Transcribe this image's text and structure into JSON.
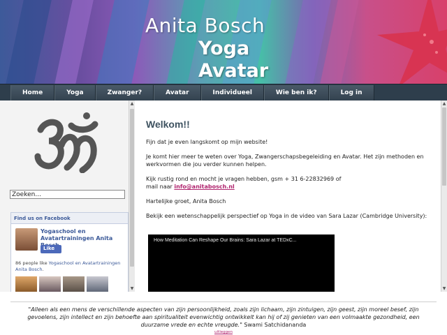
{
  "header": {
    "name": "Anita Bosch",
    "line1": "Yoga",
    "line2": "Avatar"
  },
  "nav": {
    "items": [
      "Home",
      "Yoga",
      "Zwanger?",
      "Avatar",
      "Individueel",
      "Wie ben ik?",
      "Log in"
    ]
  },
  "sidebar": {
    "om_icon": "om-symbol-icon",
    "search_value": "Zoeken...",
    "facebook": {
      "heading": "Find us on Facebook",
      "page_name": "Yogaschool en Avatartrainingen Anita Bosch",
      "like_label": "Like",
      "likes_count_text": "86 people like ",
      "likes_link": "Yogaschool en Avatartrainingen Anita Bosch",
      "likes_tail": "."
    }
  },
  "main": {
    "title": "Welkom!!",
    "p1": "Fijn dat je even langskomt op mijn website!",
    "p2": "Je komt hier meer te weten over Yoga, Zwangerschapsbegeleiding en Avatar. Het zijn methoden en werkvormen die jou verder kunnen helpen.",
    "p3_a": "Kijk rustig rond en mocht je vragen hebben, gsm + 31 6-22832969 of",
    "p3_b": "mail naar ",
    "email": "info@anitabosch.nl",
    "p4": "Hartelijke groet,  Anita Bosch",
    "p5": "Bekijk een wetenschappelijk perspectief op Yoga in de video van Sara Lazar (Cambridge University):",
    "video_title": "How Meditation Can Reshape Our Brains: Sara Lazar at TEDxC..."
  },
  "footer": {
    "quote": "\"Alleen als een mens de verschillende aspecten van zijn persoonlijkheid, zoals zijn lichaam, zijn zintuigen, zijn geest, zijn moreel besef, zijn gevoelens, zijn intellect en zijn behoefte aan spiritualiteit evenwichtig ontwikkelt kan hij of zij genieten van een volmaakte gezondheid, een duurzame vrede en echte vreugde.\"",
    "author": "Swami Satchidananda",
    "explain_link": "uitleggen"
  },
  "colors": {
    "nav_bg": "#2e3e4c",
    "heading": "#3e5260",
    "link": "#b0246e",
    "facebook": "#3b5998"
  }
}
